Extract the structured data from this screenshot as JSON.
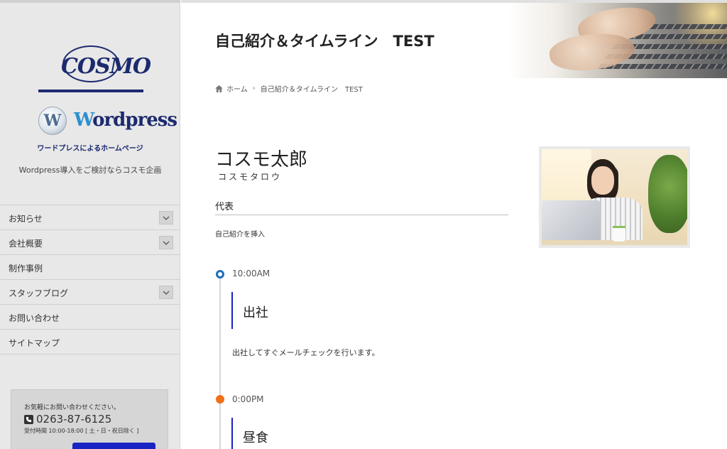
{
  "sidebar": {
    "logo": {
      "cosmo_text": "COSMO",
      "wp_badge": "W",
      "wp_initial": "W",
      "wp_rest": "ordpress",
      "caption": "ワードプレスによるホームページ"
    },
    "tagline": "Wordpress導入をご検討ならコスモ企画",
    "nav": [
      {
        "label": "お知らせ",
        "expandable": true
      },
      {
        "label": "会社概要",
        "expandable": true
      },
      {
        "label": "制作事例",
        "expandable": false
      },
      {
        "label": "スタッフブログ",
        "expandable": true
      },
      {
        "label": "お問い合わせ",
        "expandable": false
      },
      {
        "label": "サイトマップ",
        "expandable": false
      }
    ],
    "contact": {
      "note": "お気軽にお問い合わせください。",
      "phone": "0263-87-6125",
      "hours": "受付時間 10:00-18:00 [ 土・日・祝日除く ]"
    }
  },
  "header": {
    "title": "自己紹介＆タイムライン　TEST"
  },
  "breadcrumb": {
    "home": "ホーム",
    "current": "自己紹介＆タイムライン　TEST"
  },
  "profile": {
    "name": "コスモ太郎",
    "kana": "コスモタロウ",
    "role": "代表",
    "intro": "自己紹介を挿入"
  },
  "timeline": [
    {
      "time": "10:00AM",
      "title": "出社",
      "description": "出社してすぐメールチェックを行います。",
      "dot_color": "#1f6fb8"
    },
    {
      "time": "0:00PM",
      "title": "昼食",
      "description": "",
      "dot_color": "#f07018"
    }
  ],
  "colors": {
    "accent": "#1a23c4",
    "brand_navy": "#1c2a6e",
    "sidebar_bg": "#e8e8e8"
  }
}
